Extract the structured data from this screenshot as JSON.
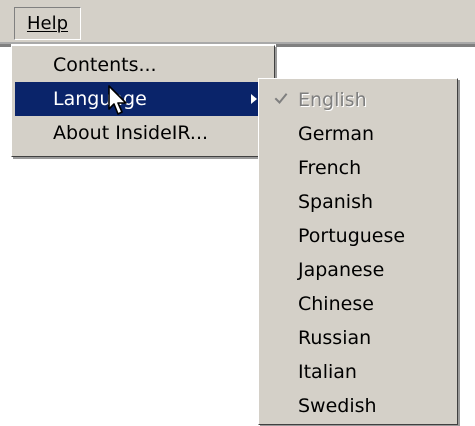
{
  "menubar": {
    "active_menu": "Help"
  },
  "menu": {
    "items": [
      {
        "label": "Contents..."
      },
      {
        "label": "Language"
      },
      {
        "label": "About InsideIR..."
      }
    ]
  },
  "submenu": {
    "items": [
      {
        "label": "English"
      },
      {
        "label": "German"
      },
      {
        "label": "French"
      },
      {
        "label": "Spanish"
      },
      {
        "label": "Portuguese"
      },
      {
        "label": "Japanese"
      },
      {
        "label": "Chinese"
      },
      {
        "label": "Russian"
      },
      {
        "label": "Italian"
      },
      {
        "label": "Swedish"
      }
    ]
  },
  "icons": {
    "menu_arrow": "chevron-right-icon",
    "checked_language": "check-icon",
    "pointer": "mouse-pointer-icon"
  },
  "colors": {
    "menu_background": "#d4d0c8",
    "highlight_background": "#0a246a",
    "highlight_text": "#ffffff",
    "disabled_text": "#7f7f7f"
  }
}
